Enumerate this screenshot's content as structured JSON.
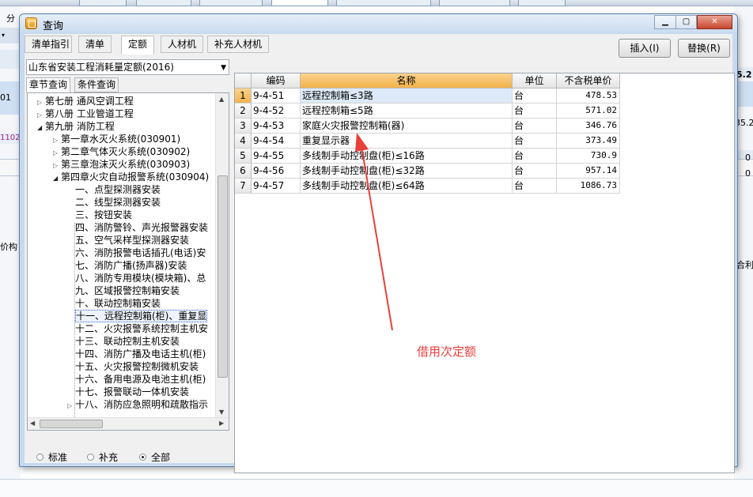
{
  "window": {
    "title": "查询",
    "controls": [
      "minimize",
      "maximize",
      "close"
    ]
  },
  "tabs": [
    {
      "label": "清单指引",
      "active": false
    },
    {
      "label": "清单",
      "active": false
    },
    {
      "label": "定额",
      "active": true
    },
    {
      "label": "人材机",
      "active": false
    },
    {
      "label": "补充人材机",
      "active": false
    }
  ],
  "buttons": {
    "insert": "插入(I)",
    "replace": "替换(R)"
  },
  "quota_library": {
    "selected": "山东省安装工程消耗量定额(2016)"
  },
  "subtabs": [
    {
      "label": "章节查询",
      "active": true
    },
    {
      "label": "条件查询",
      "active": false
    }
  ],
  "tree": [
    {
      "label": "第七册 通风空调工程",
      "level": 0,
      "state": "collapsed"
    },
    {
      "label": "第八册 工业管道工程",
      "level": 0,
      "state": "collapsed"
    },
    {
      "label": "第九册 消防工程",
      "level": 0,
      "state": "expanded"
    },
    {
      "label": "第一章水灭火系统(030901)",
      "level": 1,
      "state": "collapsed"
    },
    {
      "label": "第二章气体灭火系统(030902)",
      "level": 1,
      "state": "collapsed"
    },
    {
      "label": "第三章泡沫灭火系统(030903)",
      "level": 1,
      "state": "collapsed"
    },
    {
      "label": "第四章火灾自动报警系统(030904)",
      "level": 1,
      "state": "expanded"
    },
    {
      "label": "一、点型探测器安装",
      "level": 2,
      "state": "leaf"
    },
    {
      "label": "二、线型探测器安装",
      "level": 2,
      "state": "leaf"
    },
    {
      "label": "三、按钮安装",
      "level": 2,
      "state": "leaf"
    },
    {
      "label": "四、消防警铃、声光报警器安装",
      "level": 2,
      "state": "leaf"
    },
    {
      "label": "五、空气采样型探测器安装",
      "level": 2,
      "state": "leaf"
    },
    {
      "label": "六、消防报警电话插孔(电话)安",
      "level": 2,
      "state": "leaf"
    },
    {
      "label": "七、消防广播(扬声器)安装",
      "level": 2,
      "state": "leaf"
    },
    {
      "label": "八、消防专用模块(模块箱)、总",
      "level": 2,
      "state": "leaf"
    },
    {
      "label": "九、区域报警控制箱安装",
      "level": 2,
      "state": "leaf"
    },
    {
      "label": "十、联动控制箱安装",
      "level": 2,
      "state": "leaf"
    },
    {
      "label": "十一、远程控制箱(柜)、重复显",
      "level": 2,
      "state": "leaf",
      "selected": true
    },
    {
      "label": "十二、火灾报警系统控制主机安",
      "level": 2,
      "state": "leaf"
    },
    {
      "label": "十三、联动控制主机安装",
      "level": 2,
      "state": "leaf"
    },
    {
      "label": "十四、消防广播及电话主机(柜)",
      "level": 2,
      "state": "leaf"
    },
    {
      "label": "十五、火灾报警控制微机安装",
      "level": 2,
      "state": "leaf"
    },
    {
      "label": "十六、备用电源及电池主机(柜)",
      "level": 2,
      "state": "leaf"
    },
    {
      "label": "十七、报警联动一体机安装",
      "level": 2,
      "state": "leaf"
    },
    {
      "label": "十八、消防应急照明和疏散指示",
      "level": 2,
      "state": "collapsed"
    }
  ],
  "filter": {
    "options": [
      "标准",
      "补充",
      "全部"
    ],
    "selected": "全部"
  },
  "grid": {
    "columns": [
      "",
      "编码",
      "名称",
      "单位",
      "不含税单价"
    ],
    "rows": [
      {
        "no": "1",
        "code": "9-4-51",
        "name": "远程控制箱≤3路",
        "unit": "台",
        "price": "478.53"
      },
      {
        "no": "2",
        "code": "9-4-52",
        "name": "远程控制箱≤5路",
        "unit": "台",
        "price": "571.02"
      },
      {
        "no": "3",
        "code": "9-4-53",
        "name": "家庭火灾报警控制箱(器)",
        "unit": "台",
        "price": "346.76"
      },
      {
        "no": "4",
        "code": "9-4-54",
        "name": "重复显示器",
        "unit": "台",
        "price": "373.49"
      },
      {
        "no": "5",
        "code": "9-4-55",
        "name": "多线制手动控制盘(柜)≤16路",
        "unit": "台",
        "price": "730.9"
      },
      {
        "no": "6",
        "code": "9-4-56",
        "name": "多线制手动控制盘(柜)≤32路",
        "unit": "台",
        "price": "957.14"
      },
      {
        "no": "7",
        "code": "9-4-57",
        "name": "多线制手动控制盘(柜)≤64路",
        "unit": "台",
        "price": "1086.73"
      }
    ]
  },
  "annotation": {
    "text": "借用次定额",
    "color": "#e8403b"
  },
  "background_app": {
    "left_texts": [
      "分",
      "▾",
      "01",
      "1102",
      "价构"
    ],
    "right_texts": [
      "5.2",
      "35.2",
      "0",
      "0",
      "合利"
    ]
  }
}
